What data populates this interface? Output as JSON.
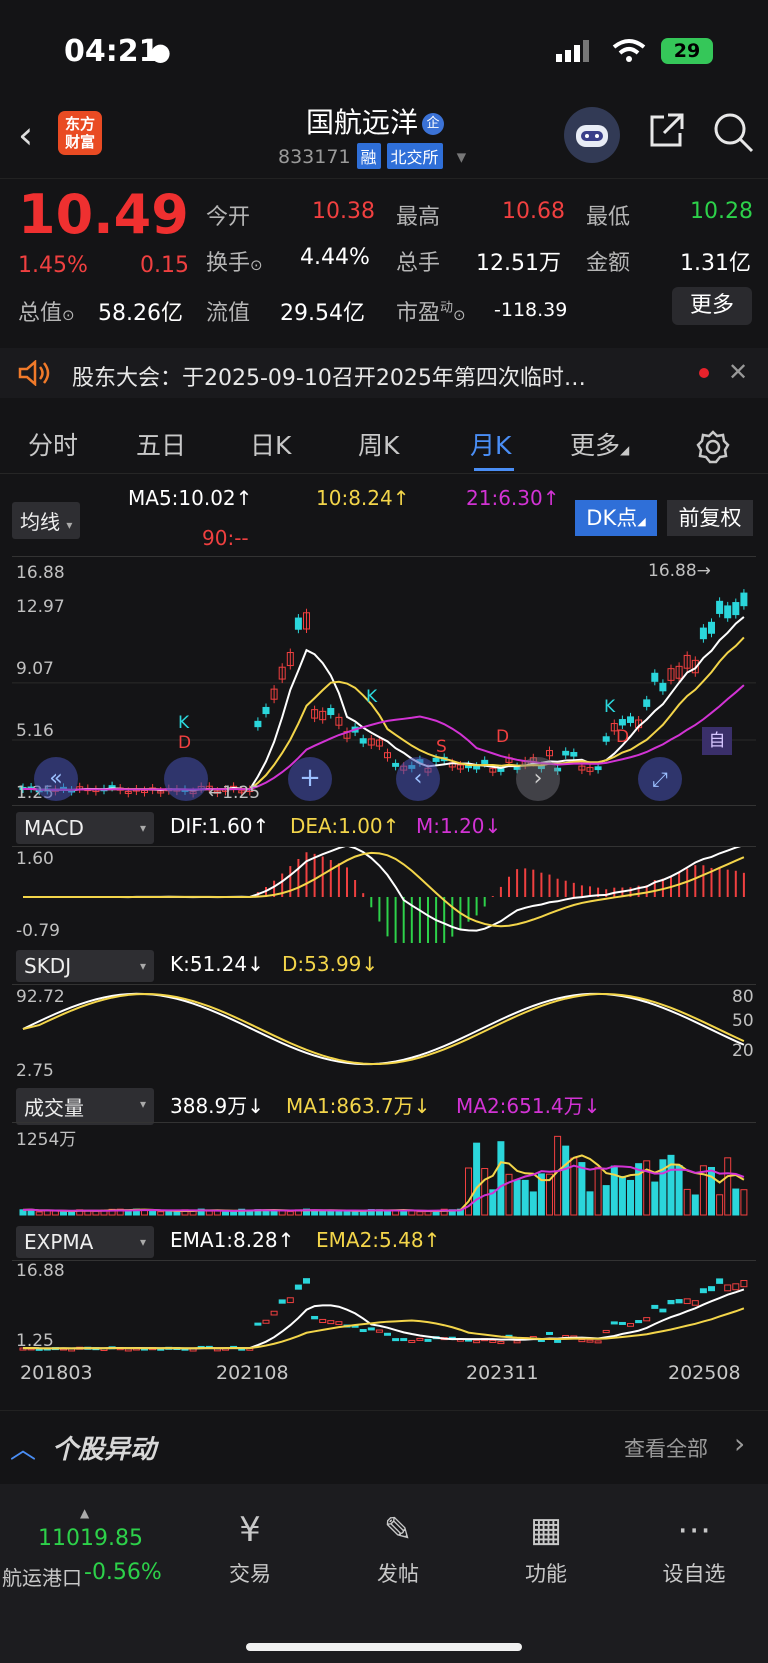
{
  "status": {
    "time": "04:21",
    "battery": "29"
  },
  "header": {
    "stock_name": "国航远洋",
    "qi_badge": "企",
    "code": "833171",
    "tag_rong": "融",
    "tag_exchange": "北交所",
    "logo_line1": "东方",
    "logo_line2": "财富"
  },
  "quote": {
    "price": "10.49",
    "change_pct": "1.45%",
    "change_amt": "0.15",
    "open_label": "今开",
    "open": "10.38",
    "high_label": "最高",
    "high": "10.68",
    "low_label": "最低",
    "low": "10.28",
    "turnover_label": "换手",
    "turnover": "4.44%",
    "volume_label": "总手",
    "volume": "12.51万",
    "amount_label": "金额",
    "amount": "1.31亿",
    "mktcap_label": "总值",
    "mktcap": "58.26亿",
    "float_label": "流值",
    "float_cap": "29.54亿",
    "pe_label": "市盈",
    "pe_sup": "动",
    "pe": "-118.39",
    "more_label": "更多"
  },
  "notice": {
    "text": "股东大会：于2025-09-10召开2025年第四次临时…"
  },
  "tabs": [
    "分时",
    "五日",
    "日K",
    "周K",
    "月K",
    "更多"
  ],
  "ma": {
    "selector": "均线",
    "ma5": "MA5:10.02↑",
    "ma10": "10:8.24↑",
    "ma21": "21:6.30↑",
    "ma90": "90:--",
    "dk_button": "DK点",
    "fq_button": "前复权"
  },
  "kline": {
    "yticks": [
      "16.88",
      "12.97",
      "9.07",
      "5.16",
      "1.25"
    ],
    "high_mark": "16.88→",
    "low_mark": "←1.25",
    "signals": [
      "K",
      "D",
      "K",
      "S",
      "D",
      "K",
      "D",
      "自"
    ]
  },
  "macd": {
    "selector": "MACD",
    "dif": "DIF:1.60↑",
    "dea": "DEA:1.00↑",
    "m": "M:1.20↓",
    "ymax": "1.60",
    "ymin": "-0.79"
  },
  "skdj": {
    "selector": "SKDJ",
    "k": "K:51.24↓",
    "d": "D:53.99↓",
    "ymax": "92.72",
    "ymin": "2.75",
    "r80": "80",
    "r50": "50",
    "r20": "20"
  },
  "vol": {
    "selector": "成交量",
    "value": "388.9万↓",
    "ma1": "MA1:863.7万↓",
    "ma2": "MA2:651.4万↓",
    "ymax": "1254万"
  },
  "expma": {
    "selector": "EXPMA",
    "ema1": "EMA1:8.28↑",
    "ema2": "EMA2:5.48↑",
    "ymax": "16.88",
    "ymin": "1.25"
  },
  "xaxis": [
    "201803",
    "202108",
    "202311",
    "202508"
  ],
  "abnormal": {
    "title": "个股异动",
    "view_all": "查看全部"
  },
  "tabbar": {
    "index_value": "11019.85",
    "index_name": "航运港口",
    "index_change": "-0.56%",
    "items": [
      "交易",
      "发帖",
      "功能",
      "设自选"
    ]
  },
  "colors": {
    "up": "#f04040",
    "down": "#2bd6db",
    "ma5": "#ffffff",
    "ma10": "#f3d54a",
    "ma21": "#d233d4",
    "accent": "#2f6fd8"
  }
}
